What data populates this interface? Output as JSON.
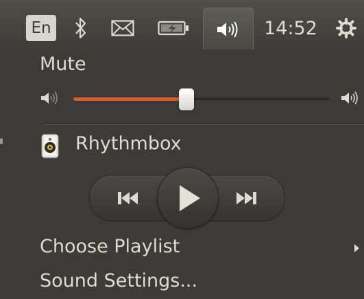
{
  "topbar": {
    "lang": "En",
    "clock": "14:52",
    "icons": [
      "bluetooth-icon",
      "mail-icon",
      "battery-icon",
      "volume-icon",
      "session-icon"
    ]
  },
  "sound_menu": {
    "mute_label": "Mute",
    "volume_level": 0.44,
    "accent_color": "#dd5a2e",
    "player_name": "Rhythmbox",
    "choose_playlist_label": "Choose Playlist",
    "sound_settings_label": "Sound Settings..."
  }
}
